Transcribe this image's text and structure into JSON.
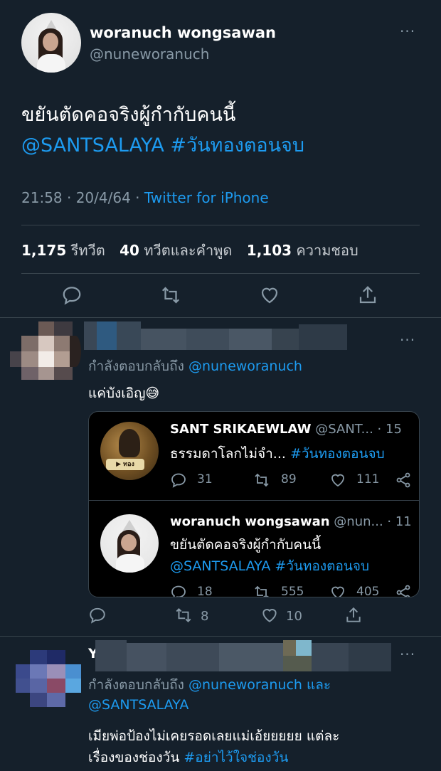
{
  "main_tweet": {
    "display_name": "woranuch wongsawan",
    "handle": "@nuneworanuch",
    "more": "···",
    "text_line1": "ขยันตัดคอจริงผู้กำกับคนนี้",
    "mention": "@SANTSALAYA",
    "hashtag": "#วันทองตอนจบ",
    "time": "21:58 · 20/4/64 · ",
    "source": "Twitter for iPhone",
    "stats": {
      "retweets": "1,175",
      "retweets_label": "รีทวีต",
      "quotes": "40",
      "quotes_label": "ทวีตและคำพูด",
      "likes": "1,103",
      "likes_label": "ความชอบ"
    }
  },
  "reply1": {
    "replying_to": "กำลังตอบกลับถึง",
    "replying_handle": "@nuneworanuch",
    "text": "แค่บังเอิญ",
    "emoji": "😅",
    "reply_count": "",
    "retweet_count": "8",
    "like_count": "10",
    "quoted_1": {
      "name": "SANT SRIKAEWLAW",
      "handle": "@SANT...",
      "time": "· 15",
      "text": "ธรรมดาโลกไม่จำ...",
      "hashtag": "#วันทองตอนจบ",
      "replies": "31",
      "retweets": "89",
      "likes": "111"
    },
    "quoted_2": {
      "name": "woranuch wongsawan",
      "handle": "@nun...",
      "time": "· 11",
      "text": "ขยันตัดคอจริงผู้กำกับคนนี้",
      "mention": "@SANTSALAYA",
      "hashtag": "#วันทองตอนจบ",
      "replies": "18",
      "retweets": "555",
      "likes": "405"
    }
  },
  "reply2": {
    "name_initial": "Y",
    "replying_to": "กำลังตอบกลับถึง",
    "replying_handle": "@nuneworanuch",
    "and": "และ",
    "replying_handle2": "@SANTSALAYA",
    "text_line1": "เมียพ่อป้องไม่เคยรอดเลยแม่เอ้ยยยยย แต่ละ",
    "text_line2": "เรื่องของช่องวัน",
    "hashtag": "#อย่าไว้ใจช่องวัน"
  },
  "colors": {
    "background": "#15202b",
    "accent": "#1d9bf0",
    "secondary": "#8899a6",
    "divider": "#38444d"
  }
}
